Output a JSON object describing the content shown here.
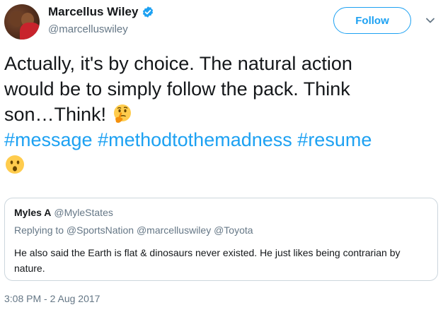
{
  "author": {
    "display_name": "Marcellus Wiley",
    "handle": "@marcelluswiley",
    "verified": true,
    "avatar_icon": "avatar-photo"
  },
  "follow_label": "Follow",
  "tweet": {
    "line1": "Actually, it's by choice. The natural action",
    "line2": "would be to simply follow the pack. Think",
    "line3_text": "son…Think!",
    "line3_emoji": "thinking-face-emoji",
    "hashtags": [
      "#message",
      "#methodtothemadness",
      "#resume"
    ],
    "trailing_emoji": "hushed-face-emoji"
  },
  "quoted_tweet": {
    "name": "Myles A",
    "handle": "@MyleStates",
    "replying_to": "Replying to @SportsNation @marcelluswiley @Toyota",
    "text": "He also said the Earth is flat & dinosaurs never existed. He just likes being contrarian by nature."
  },
  "timestamp": "3:08 PM - 2 Aug 2017",
  "colors": {
    "accent": "#1da1f2",
    "secondary_text": "#657786",
    "primary_text": "#14171a",
    "border": "#ccd6dd"
  }
}
